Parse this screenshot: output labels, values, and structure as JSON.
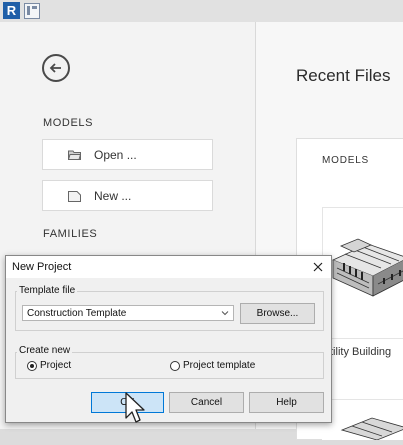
{
  "app": {
    "logo_letter": "R"
  },
  "sidebar": {
    "models_label": "MODELS",
    "open_label": "Open ...",
    "new_label": "New ...",
    "families_label": "FAMILIES"
  },
  "main": {
    "title": "Recent Files",
    "models_header": "MODELS",
    "recent_item_caption": "tility Building"
  },
  "dialog": {
    "title": "New Project",
    "template_group_label": "Template file",
    "template_value": "Construction Template",
    "browse_label": "Browse...",
    "create_new_label": "Create new",
    "radio_project_label": "Project",
    "radio_template_label": "Project template",
    "selected_option": "Project",
    "ok_label": "OK",
    "cancel_label": "Cancel",
    "help_label": "Help"
  },
  "colors": {
    "accent": "#0078d7",
    "logo_bg": "#1f5fa8"
  }
}
